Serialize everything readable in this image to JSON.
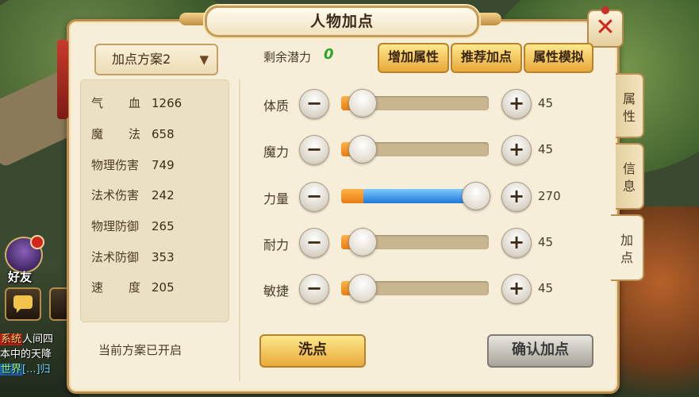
{
  "window": {
    "title": "人物加点",
    "close_label": "✕"
  },
  "hud": {
    "friend_label": "好友",
    "chat_log": [
      {
        "tag": "系统",
        "text": "人间四"
      },
      {
        "tag": "",
        "text": "本中的天降"
      },
      {
        "tag": "世界",
        "text": "[...]归"
      }
    ]
  },
  "scheme": {
    "selected": "加点方案2",
    "status": "当前方案已开启"
  },
  "stats": [
    {
      "name": "气血",
      "value": "1266"
    },
    {
      "name": "魔法",
      "value": "658"
    },
    {
      "name": "物理伤害",
      "value": "749"
    },
    {
      "name": "法术伤害",
      "value": "242"
    },
    {
      "name": "物理防御",
      "value": "265"
    },
    {
      "name": "法术防御",
      "value": "353"
    },
    {
      "name": "速度",
      "value": "205"
    }
  ],
  "potential": {
    "label": "剩余潜力",
    "value": "0"
  },
  "actions": {
    "add_attr": "增加属性",
    "recommend": "推荐加点",
    "simulate": "属性模拟",
    "wash": "洗点",
    "confirm": "确认加点"
  },
  "attributes": [
    {
      "name": "体质",
      "value": "45",
      "level": 0.14
    },
    {
      "name": "魔力",
      "value": "45",
      "level": 0.14
    },
    {
      "name": "力量",
      "value": "270",
      "level": 1.0
    },
    {
      "name": "耐力",
      "value": "45",
      "level": 0.14
    },
    {
      "name": "敏捷",
      "value": "45",
      "level": 0.14
    }
  ],
  "side_tabs": [
    {
      "label": "属性",
      "active": false
    },
    {
      "label": "信息",
      "active": false
    },
    {
      "label": "加点",
      "active": true
    }
  ],
  "colors": {
    "panel": "#f6eed9",
    "gold": "#e8a93a",
    "potential": "#2ea52a",
    "close": "#d2221a",
    "bar_orange": "#e87c14",
    "bar_blue": "#1e78d6"
  }
}
